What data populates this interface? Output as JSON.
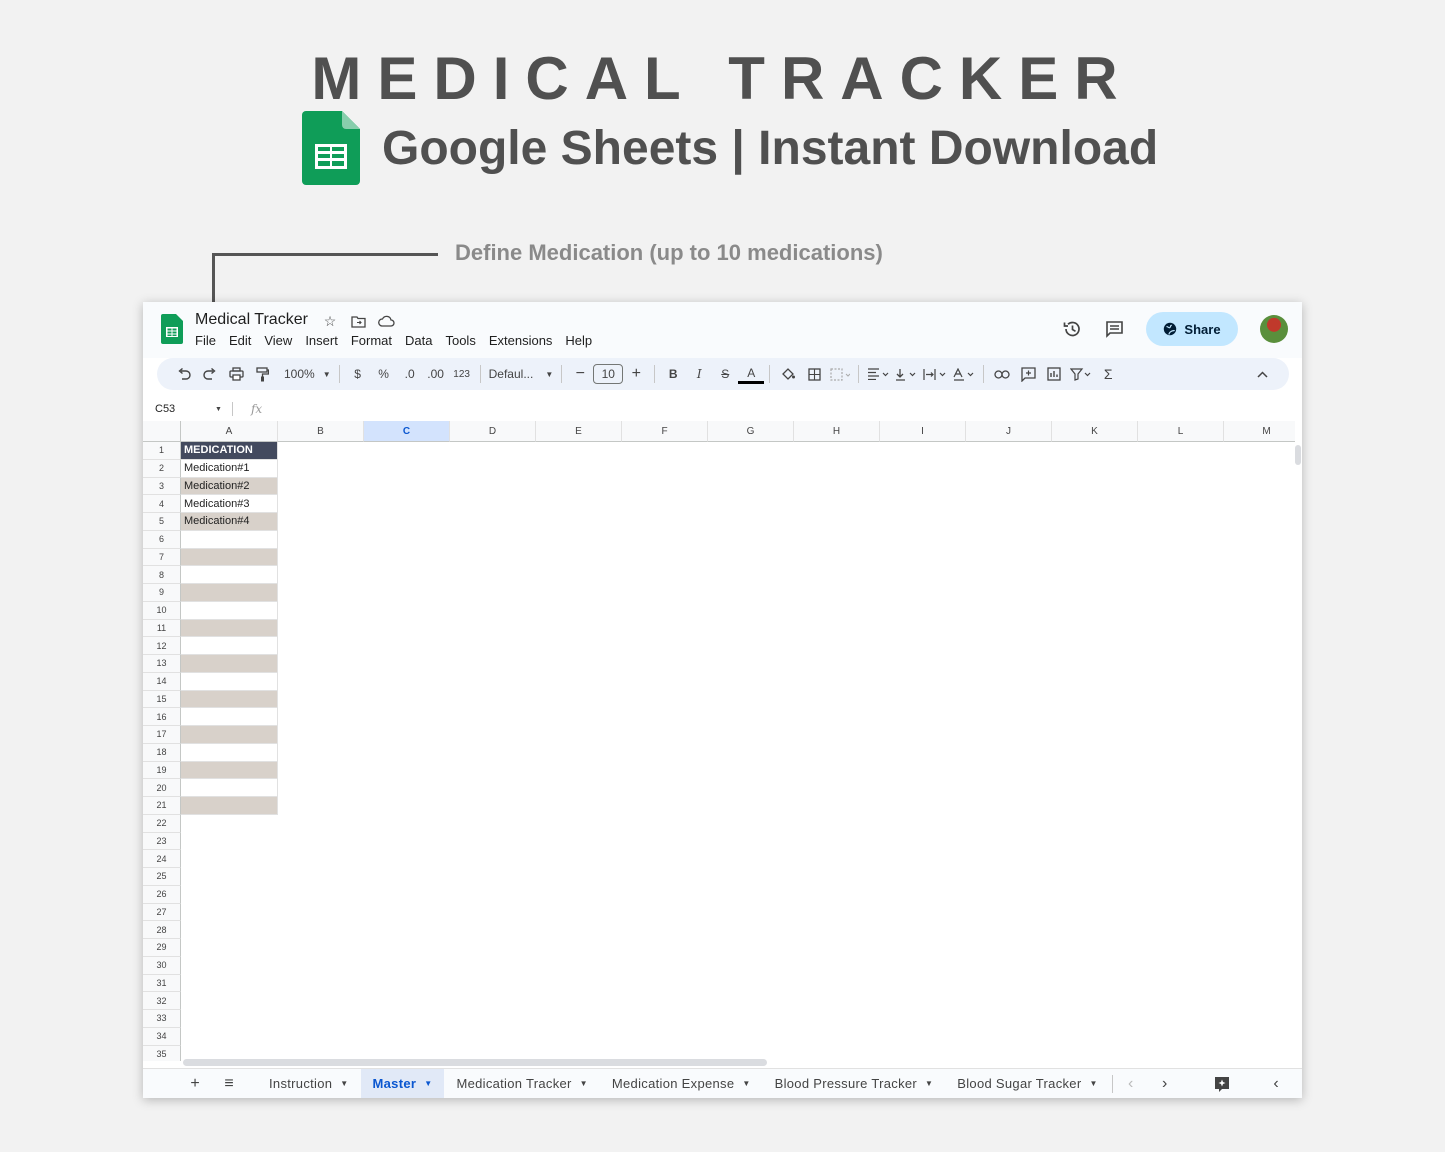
{
  "hero": {
    "title": "MEDICAL TRACKER",
    "subtitle": "Google Sheets | Instant Download"
  },
  "callout": {
    "text": "Define Medication (up to 10 medications)"
  },
  "app": {
    "doc_title": "Medical Tracker",
    "menu": [
      "File",
      "Edit",
      "View",
      "Insert",
      "Format",
      "Data",
      "Tools",
      "Extensions",
      "Help"
    ],
    "share_label": "Share",
    "icons": [
      "sheets-logo-icon",
      "star-icon",
      "move-folder-icon",
      "cloud-icon",
      "history-icon",
      "comment-icon",
      "globe-icon",
      "avatar"
    ]
  },
  "toolbar": {
    "zoom": "100%",
    "currency": "$",
    "percent": "%",
    "decrease_decimal": ".0",
    "increase_decimal": ".00",
    "number_format": "123",
    "font": "Defaul...",
    "font_size": "10",
    "bold": "B",
    "italic": "I",
    "strike": "S",
    "text_color": "A",
    "sum": "Σ"
  },
  "formula_bar": {
    "name_box": "C53",
    "fx": "fx"
  },
  "columns": [
    "A",
    "B",
    "C",
    "D",
    "E",
    "F",
    "G",
    "H",
    "I",
    "J",
    "K",
    "L",
    "M"
  ],
  "active_column": "C",
  "rows": [
    "1",
    "2",
    "3",
    "4",
    "5",
    "6",
    "7",
    "8",
    "9",
    "10",
    "11",
    "12",
    "13",
    "14",
    "15",
    "16",
    "17",
    "18",
    "19",
    "20",
    "21",
    "22",
    "23",
    "24",
    "25",
    "26",
    "27",
    "28",
    "29",
    "30",
    "31",
    "32",
    "33",
    "34",
    "35"
  ],
  "column_a": {
    "header": "MEDICATION",
    "items": [
      "Medication#1",
      "Medication#2",
      "Medication#3",
      "Medication#4",
      "",
      "",
      "",
      "",
      "",
      "",
      "",
      "",
      "",
      "",
      "",
      "",
      "",
      "",
      "",
      ""
    ]
  },
  "sheet_tabs": [
    "Instruction",
    "Master",
    "Medication Tracker",
    "Medication Expense",
    "Blood Pressure Tracker",
    "Blood Sugar Tracker"
  ],
  "active_tab": "Master",
  "colors": {
    "header_fill": "#434a5e",
    "shade_fill": "#d8d1ca",
    "share_button": "#c2e7ff",
    "active_tab": "#0b57d0"
  }
}
